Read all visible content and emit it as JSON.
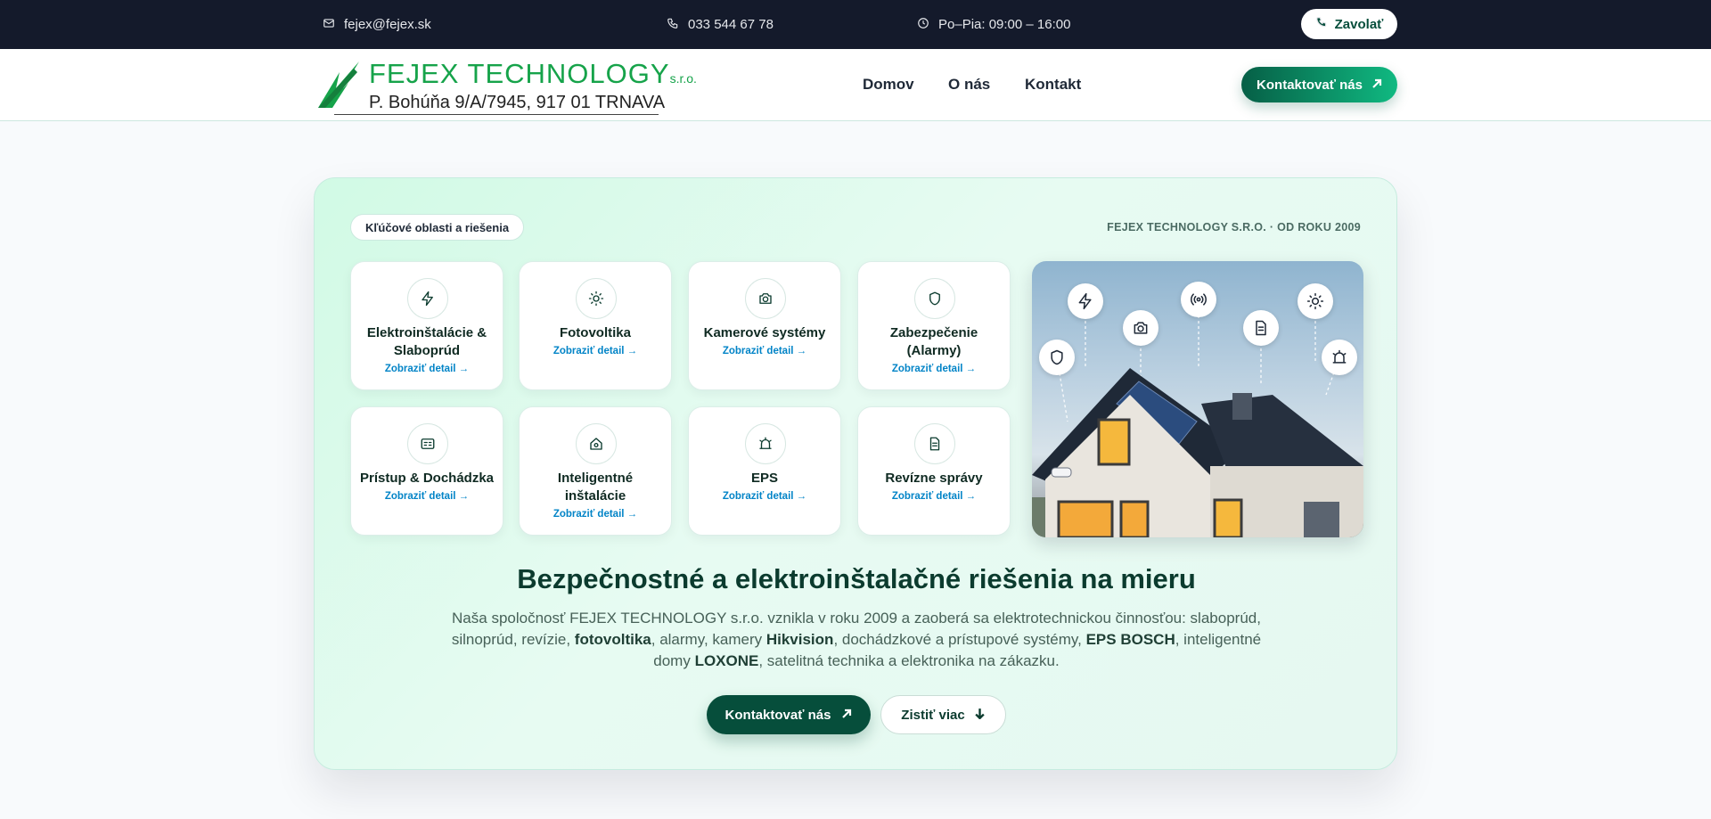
{
  "topbar": {
    "email": "fejex@fejex.sk",
    "phone": "033 544 67 78",
    "hours": "Po–Pia: 09:00 – 16:00",
    "call_label": "Zavolať"
  },
  "header": {
    "logo_name": "FEJEX TECHNOLOGY",
    "logo_suffix": "s.r.o.",
    "logo_address": "P. Bohúňa 9/A/7945, 917 01 TRNAVA",
    "nav": [
      "Domov",
      "O nás",
      "Kontakt"
    ],
    "cta_label": "Kontaktovať nás"
  },
  "hero": {
    "pill": "Kľúčové oblasti a riešenia",
    "since": "FEJEX TECHNOLOGY S.R.O. · OD ROKU 2009",
    "tiles": [
      {
        "title": "Elektroinštalácie & Slaboprúd",
        "link": "Zobraziť detail →",
        "icon": "lightning-icon"
      },
      {
        "title": "Fotovoltika",
        "link": "Zobraziť detail →",
        "icon": "sun-icon"
      },
      {
        "title": "Kamerové systémy",
        "link": "Zobraziť detail →",
        "icon": "camera-icon"
      },
      {
        "title": "Zabezpečenie (Alarmy)",
        "link": "Zobraziť detail →",
        "icon": "shield-icon"
      },
      {
        "title": "Prístup & Dochádzka",
        "link": "Zobraziť detail →",
        "icon": "id-card-icon"
      },
      {
        "title": "Inteligentné inštalácie",
        "link": "Zobraziť detail →",
        "icon": "smart-home-icon"
      },
      {
        "title": "EPS",
        "link": "Zobraziť detail →",
        "icon": "fire-alarm-icon"
      },
      {
        "title": "Revízne správy",
        "link": "Zobraziť detail →",
        "icon": "document-icon"
      }
    ],
    "headline": "Bezpečnostné a elektroinštalačné riešenia na mieru",
    "desc": {
      "p1": "Naša spoločnosť FEJEX TECHNOLOGY s.r.o. vznikla v roku 2009 a zaoberá sa elektrotechnickou činnosťou: slaboprúd, silnoprúd, revízie, ",
      "b1": "fotovoltika",
      "p2": ", alarmy, kamery ",
      "b2": "Hikvision",
      "p3": ", dochádzkové a prístupové systémy, ",
      "b3": "EPS BOSCH",
      "p4": ", inteligentné domy ",
      "b4": "LOXONE",
      "p5": ", satelitná technika a elektronika na zákazku."
    },
    "primary_label": "Kontaktovať nás",
    "secondary_label": "Zistiť viac"
  },
  "colors": {
    "topbar_bg": "#141a2b",
    "brand_green": "#16a34a",
    "dark_green": "#064e3b",
    "link_blue": "#0284c7"
  }
}
